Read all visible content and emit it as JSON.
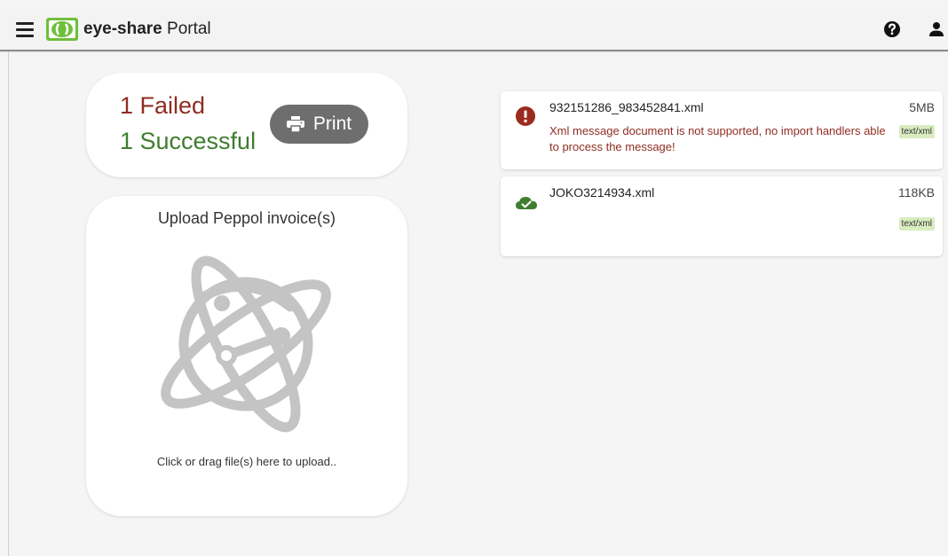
{
  "header": {
    "logo_brand": "eye-share",
    "logo_suffix": "Portal",
    "icons": {
      "menu": "hamburger-menu-icon",
      "logo": "eye-share-logo",
      "help": "help-circle-icon",
      "account": "user-account-icon"
    }
  },
  "summary": {
    "failed": "1 Failed",
    "successful": "1 Successful",
    "print_label": "Print",
    "colors": {
      "failed": "#8f2d22",
      "successful": "#3f7d2f",
      "button": "#6e6e6e"
    }
  },
  "upload": {
    "title": "Upload Peppol invoice(s)",
    "hint": "Click or drag file(s) here to upload..",
    "icon": "peppol-network-globe-icon"
  },
  "files": [
    {
      "name": "932151286_983452841.xml",
      "size": "5MB",
      "status": "error",
      "message": "Xml message document is not supported, no import handlers able to process the message!",
      "mime": "text/xml",
      "icon": "error-circle-icon"
    },
    {
      "name": "JOKO3214934.xml",
      "size": "118KB",
      "status": "success",
      "message": "",
      "mime": "text/xml",
      "icon": "cloud-check-icon"
    }
  ],
  "colors": {
    "error": "#8f2d22",
    "success": "#3f7d2f",
    "mime_badge": "#d9ecc0",
    "logo_green": "#6fbf3b"
  }
}
